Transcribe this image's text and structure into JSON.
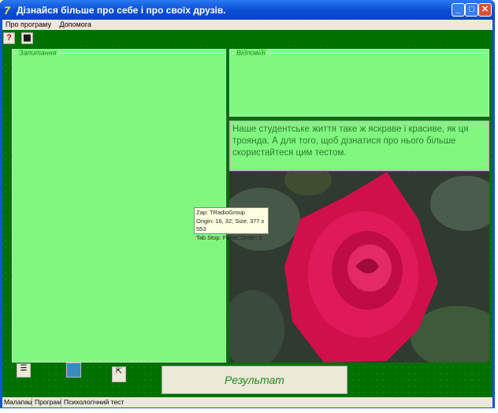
{
  "window": {
    "title": "Дізнайся більше про себе і про своїх друзів.",
    "app_icon": "7"
  },
  "menu": [
    "Про програму",
    "Допомога"
  ],
  "toolbar": [
    {
      "icon": "help-icon",
      "glyph": "?"
    },
    {
      "icon": "calendar-icon",
      "glyph": "▦"
    }
  ],
  "questions_group": {
    "label": "Запитання"
  },
  "answers_group": {
    "label": "Відповіді"
  },
  "info_text": "  Наше студентське життя таке ж яскраве і красиве, як ця троянда. А для того, щоб дізнатися про нього більше  скористайтеся цим тестом.",
  "tooltip": {
    "line1": "Zap: TRadioGroup",
    "line2": "Origin: 16, 32; Size: 377 x 553",
    "line3": "Tab Stop: False; Order: 0"
  },
  "result_button": "Результат",
  "status": [
    "Малапащ",
    "Програма",
    "Психологічний тест"
  ]
}
